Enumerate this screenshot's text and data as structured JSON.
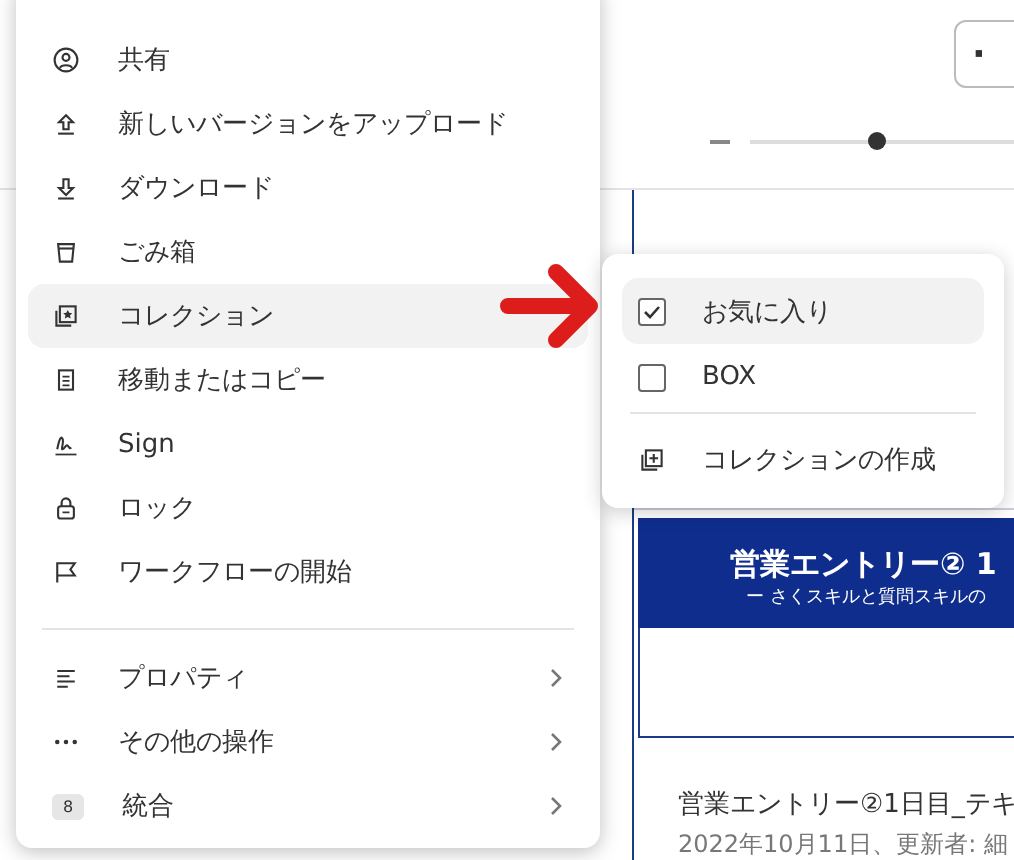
{
  "toolbar": {
    "more_button": "·"
  },
  "zoom_slider": {
    "level": 0.45
  },
  "document_card": {
    "banner_title": "営業エントリー②  1",
    "banner_subtitle": "ー さくスキルと質問スキルの",
    "title": "営業エントリー②1日目_テキ",
    "meta": "2022年10月11日、更新者: 細"
  },
  "menu": {
    "groups": [
      [
        {
          "label": "共有",
          "selected": false
        },
        {
          "label": "新しいバージョンをアップロード",
          "selected": false
        },
        {
          "label": "ダウンロード",
          "selected": false
        },
        {
          "label": "ごみ箱",
          "selected": false
        },
        {
          "label": "コレクション",
          "selected": true
        },
        {
          "label": "移動またはコピー",
          "selected": false
        },
        {
          "label": "Sign",
          "selected": false
        },
        {
          "label": "ロック",
          "selected": false
        },
        {
          "label": "ワークフローの開始",
          "selected": false
        }
      ],
      [
        {
          "label": "プロパティ",
          "selected": false,
          "has_submenu": true
        },
        {
          "label": "その他の操作",
          "selected": false,
          "has_submenu": true
        },
        {
          "label": "統合",
          "selected": false,
          "has_submenu": true,
          "badge": "8"
        }
      ]
    ]
  },
  "submenu": {
    "items": [
      {
        "label": "お気に入り",
        "checked": true,
        "selected": true
      },
      {
        "label": "BOX",
        "checked": false,
        "selected": false
      }
    ],
    "action": {
      "label": "コレクションの作成"
    }
  }
}
